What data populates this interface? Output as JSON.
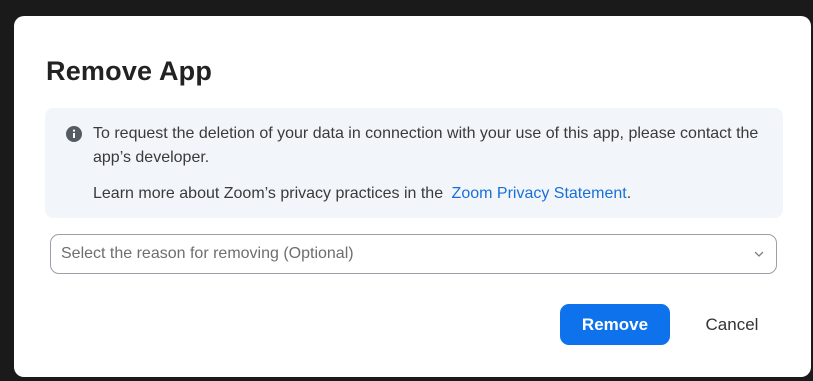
{
  "dialog": {
    "title": "Remove App",
    "notice": {
      "icon": "info-icon",
      "message": "To request the deletion of your data in connection with your use of this app, please contact the app’s developer.",
      "privacy_prefix": "Learn more about Zoom’s privacy practices in the",
      "privacy_link": "Zoom Privacy Statement",
      "privacy_suffix": "."
    },
    "reason_select": {
      "placeholder": "Select the reason for removing (Optional)",
      "icon": "chevron-down-icon"
    },
    "buttons": {
      "remove": "Remove",
      "cancel": "Cancel"
    }
  },
  "colors": {
    "primary": "#0e72ed",
    "link": "#1a6fd6",
    "notice_bg": "#f2f6fb",
    "overlay": "#1a1a1a"
  }
}
